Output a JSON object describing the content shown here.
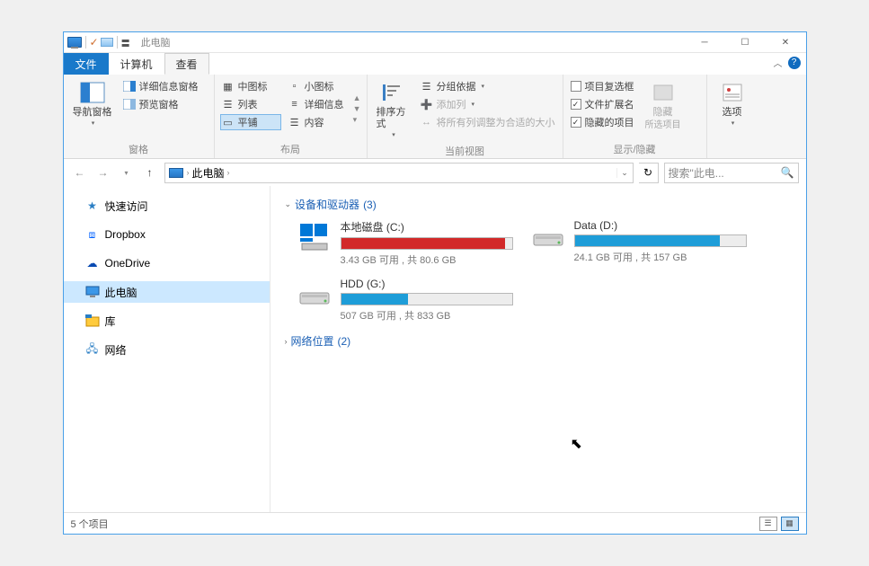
{
  "window": {
    "title": "此电脑"
  },
  "tabs": {
    "file": "文件",
    "computer": "计算机",
    "view": "查看"
  },
  "ribbon": {
    "panes": {
      "nav_pane": "导航窗格",
      "preview_pane": "预览窗格",
      "detail_pane": "详细信息窗格",
      "label": "窗格"
    },
    "layout": {
      "medium_icons": "中图标",
      "small_icons": "小图标",
      "list": "列表",
      "details": "详细信息",
      "tiles": "平铺",
      "content": "内容",
      "label": "布局"
    },
    "current_view": {
      "sort_by": "排序方式",
      "group_by": "分组依据",
      "add_column": "添加列",
      "fit_columns": "将所有列调整为合适的大小",
      "label": "当前视图"
    },
    "show_hide": {
      "item_checkbox": "项目复选框",
      "file_ext": "文件扩展名",
      "hidden_items": "隐藏的项目",
      "hide": "隐藏",
      "hide_sub": "所选项目",
      "label": "显示/隐藏"
    },
    "options": "选项"
  },
  "address": {
    "this_pc": "此电脑"
  },
  "search": {
    "placeholder": "搜索\"此电..."
  },
  "sidebar": {
    "items": [
      {
        "label": "快速访问"
      },
      {
        "label": "Dropbox"
      },
      {
        "label": "OneDrive"
      },
      {
        "label": "此电脑"
      },
      {
        "label": "库"
      },
      {
        "label": "网络"
      }
    ]
  },
  "groups": {
    "drives": {
      "title": "设备和驱动器",
      "count": "(3)"
    },
    "network": {
      "title": "网络位置",
      "count": "(2)"
    }
  },
  "drives": [
    {
      "name": "本地磁盘 (C:)",
      "free": "3.43 GB 可用 , 共 80.6 GB",
      "fill_pct": 96,
      "color": "red",
      "os": true
    },
    {
      "name": "Data (D:)",
      "free": "24.1 GB 可用 , 共 157 GB",
      "fill_pct": 85,
      "color": "blue",
      "os": false
    },
    {
      "name": "HDD (G:)",
      "free": "507 GB 可用 , 共 833 GB",
      "fill_pct": 39,
      "color": "blue",
      "os": false
    }
  ],
  "status": {
    "items": "5 个项目"
  }
}
